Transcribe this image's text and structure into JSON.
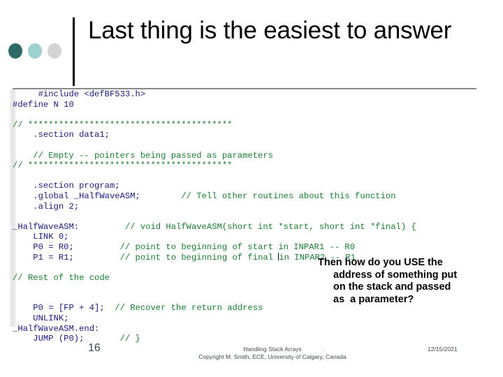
{
  "slide": {
    "title": "Last thing is the easiest to answer",
    "accent_dark": "#2f6b66",
    "accent_light": "#9fd0d0",
    "accent_gray": "#d4d4d4"
  },
  "code": {
    "comment_color": "#1b7a33",
    "keyword_color": "#1a1a7a",
    "lines": [
      {
        "id": "l01",
        "segs": [
          {
            "t": "     #include <defBF533.h>",
            "c": "navy"
          }
        ]
      },
      {
        "id": "l02",
        "segs": [
          {
            "t": "#define N 10",
            "c": "navy"
          }
        ]
      },
      {
        "id": "l03",
        "segs": [
          {
            "t": "",
            "c": "green"
          }
        ]
      },
      {
        "id": "l04",
        "segs": [
          {
            "t": "// ****************************************",
            "c": "green"
          }
        ]
      },
      {
        "id": "l05",
        "segs": [
          {
            "t": "    .section data1;",
            "c": "navy"
          }
        ]
      },
      {
        "id": "l06",
        "segs": [
          {
            "t": "",
            "c": "green"
          }
        ]
      },
      {
        "id": "l07",
        "segs": [
          {
            "t": "    // Empty -- pointers being passed as parameters",
            "c": "green"
          }
        ]
      },
      {
        "id": "l08",
        "segs": [
          {
            "t": "// ****************************************",
            "c": "green"
          }
        ]
      },
      {
        "id": "l09",
        "segs": [
          {
            "t": "",
            "c": "green"
          }
        ]
      },
      {
        "id": "l10",
        "segs": [
          {
            "t": "    .section program;",
            "c": "navy"
          }
        ]
      },
      {
        "id": "l11",
        "segs": [
          {
            "t": "    .global _HalfWaveASM;",
            "c": "navy"
          },
          {
            "t": "        ",
            "c": "green"
          },
          {
            "t": "// Tell other routines about this function",
            "c": "green"
          }
        ]
      },
      {
        "id": "l12",
        "segs": [
          {
            "t": "    .align 2;",
            "c": "navy"
          }
        ]
      },
      {
        "id": "l13",
        "segs": [
          {
            "t": "",
            "c": "green"
          }
        ]
      },
      {
        "id": "l14",
        "segs": [
          {
            "t": "_HalfWaveASM:",
            "c": "navy"
          },
          {
            "t": "         ",
            "c": "green"
          },
          {
            "t": "// void HalfWaveASM(short int *start, short int *final) {",
            "c": "green"
          }
        ]
      },
      {
        "id": "l15",
        "segs": [
          {
            "t": "    LINK 0;",
            "c": "navy"
          }
        ]
      },
      {
        "id": "l16",
        "segs": [
          {
            "t": "    P0 = R0;",
            "c": "navy"
          },
          {
            "t": "         ",
            "c": "green"
          },
          {
            "t": "// point to beginning of start in INPAR1 -- R0",
            "c": "green"
          }
        ]
      },
      {
        "id": "l17",
        "segs": [
          {
            "t": "    P1 = R1;",
            "c": "navy"
          },
          {
            "t": "         ",
            "c": "green"
          },
          {
            "t": "// point to beginning of final ",
            "c": "green"
          },
          {
            "t": "CARET",
            "c": "caret"
          },
          {
            "t": "in INPAR2 -- R1",
            "c": "green"
          }
        ]
      },
      {
        "id": "l18",
        "segs": [
          {
            "t": "",
            "c": "green"
          }
        ]
      },
      {
        "id": "l19",
        "segs": [
          {
            "t": "// Rest of the code",
            "c": "green"
          }
        ]
      },
      {
        "id": "l20",
        "segs": [
          {
            "t": "",
            "c": "green"
          }
        ]
      },
      {
        "id": "l21",
        "segs": [
          {
            "t": "",
            "c": "green"
          }
        ]
      },
      {
        "id": "l22",
        "segs": [
          {
            "t": "    P0 = [FP + 4];",
            "c": "navy"
          },
          {
            "t": "  ",
            "c": "green"
          },
          {
            "t": "// Recover the return address",
            "c": "green"
          }
        ]
      },
      {
        "id": "l23",
        "segs": [
          {
            "t": "    UNLINK;",
            "c": "navy"
          }
        ]
      },
      {
        "id": "l24",
        "segs": [
          {
            "t": "_HalfWaveASM.end:",
            "c": "navy"
          }
        ]
      },
      {
        "id": "l25",
        "segs": [
          {
            "t": "    JUMP (P0);",
            "c": "navy"
          },
          {
            "t": "       ",
            "c": "green"
          },
          {
            "t": "// }",
            "c": "green"
          }
        ]
      }
    ]
  },
  "callout": {
    "line1": "Then how do you USE the",
    "line2": "address of something put",
    "line3": "on the stack and passed",
    "line4": "as  a parameter?"
  },
  "footer": {
    "page_number": "16",
    "title_line": "Handling Stack Arrays",
    "copyright_line": "Copyright M. Smith, ECE, University of Calgary, Canada",
    "separator": ".",
    "date": "12/15/2021"
  }
}
